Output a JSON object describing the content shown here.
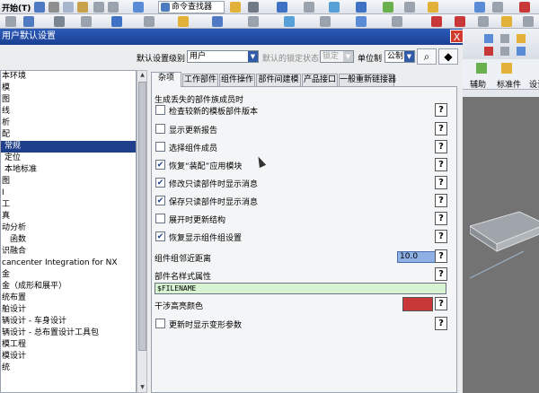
{
  "toolbar": {
    "start_label": "开始(T)",
    "find_command_label": "命令查找器",
    "icons": [
      "save-icon",
      "cut-icon",
      "copy-icon",
      "paste-icon",
      "undo-icon",
      "redo-icon",
      "select-icon",
      "snap-icon",
      "view-icon",
      "shade-icon",
      "layer-icon",
      "line-icon",
      "arc-icon",
      "dim-icon"
    ]
  },
  "dialog": {
    "title": "用户默认设置",
    "close_label": "X",
    "level_label": "默认设置级别",
    "level_value": "用户",
    "lock_label": "默认的锁定状态",
    "lock_value": "锁定",
    "unit_label": "单位制",
    "unit_value": "公制",
    "find_icon": "binoculars-icon",
    "manage_icon": "manage-icon"
  },
  "tree": {
    "items": [
      {
        "label": "本环境",
        "level": 0,
        "selected": false
      },
      {
        "label": "模",
        "level": 0,
        "selected": false
      },
      {
        "label": "图",
        "level": 0,
        "selected": false
      },
      {
        "label": "线",
        "level": 0,
        "selected": false
      },
      {
        "label": "析",
        "level": 0,
        "selected": false
      },
      {
        "label": "配",
        "level": 0,
        "selected": false
      },
      {
        "label": "常规",
        "level": 1,
        "selected": true
      },
      {
        "label": "定位",
        "level": 1,
        "selected": false
      },
      {
        "label": "本地标准",
        "level": 1,
        "selected": false
      },
      {
        "label": "图",
        "level": 0,
        "selected": false
      },
      {
        "label": "I",
        "level": 0,
        "selected": false
      },
      {
        "label": "工",
        "level": 0,
        "selected": false
      },
      {
        "label": "真",
        "level": 0,
        "selected": false
      },
      {
        "label": "动分析",
        "level": 0,
        "selected": false
      },
      {
        "label": "函数",
        "level": 2,
        "selected": false
      },
      {
        "label": "识融合",
        "level": 0,
        "selected": false
      },
      {
        "label": "cancenter Integration for NX",
        "level": 0,
        "selected": false
      },
      {
        "label": "金",
        "level": 0,
        "selected": false
      },
      {
        "label": "金（成形和展平）",
        "level": 0,
        "selected": false
      },
      {
        "label": "统布置",
        "level": 0,
        "selected": false
      },
      {
        "label": "舶设计",
        "level": 0,
        "selected": false
      },
      {
        "label": "辆设计 - 车身设计",
        "level": 0,
        "selected": false
      },
      {
        "label": "辆设计 - 总布置设计工具包",
        "level": 0,
        "selected": false
      },
      {
        "label": "模工程",
        "level": 0,
        "selected": false
      },
      {
        "label": "模设计",
        "level": 0,
        "selected": false
      },
      {
        "label": "统",
        "level": 0,
        "selected": false
      }
    ]
  },
  "tabs": [
    "杂项",
    "工作部件",
    "组件操作",
    "部件间建模",
    "产品接口",
    "一般重新链接器"
  ],
  "panel": {
    "group_title": "生成丢失的部件族成员时",
    "checkboxes": [
      {
        "label": "检查较新的模板部件版本",
        "checked": false
      },
      {
        "label": "显示更新报告",
        "checked": false
      },
      {
        "label": "选择组件成员",
        "checked": false
      },
      {
        "label": "恢复“装配”应用模块",
        "checked": true
      },
      {
        "label": "修改只读部件时显示消息",
        "checked": true
      },
      {
        "label": "保存只读部件时显示消息",
        "checked": true
      },
      {
        "label": "展开时更新结构",
        "checked": false
      },
      {
        "label": "恢复显示组件组设置",
        "checked": true
      }
    ],
    "near_distance_label": "组件组邻近距离",
    "near_distance_value": "10.0",
    "name_style_label": "部件名样式属性",
    "name_style_value": "$FILENAME",
    "interference_color_label": "干涉高亮颜色",
    "interference_color": "#c93838",
    "update_param_label": "更新时显示变形参数",
    "update_param_checked": false,
    "help_label": "?",
    "check_mark": "✔"
  },
  "nx": {
    "label_left": "辅助",
    "label_mid": "标准件",
    "label_right": "设计"
  }
}
